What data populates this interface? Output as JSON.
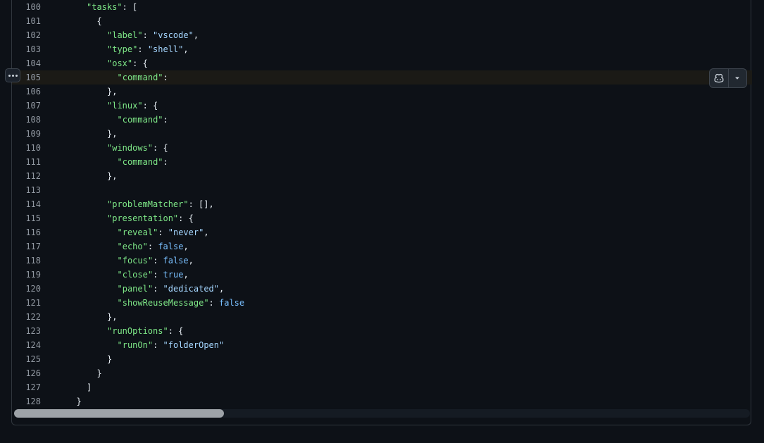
{
  "editor": {
    "lines": [
      {
        "n": "100",
        "indent": 4,
        "tokens": [
          {
            "t": "k",
            "v": "\"tasks\""
          },
          {
            "t": "p",
            "v": ": ["
          }
        ]
      },
      {
        "n": "101",
        "indent": 6,
        "tokens": [
          {
            "t": "p",
            "v": "{"
          }
        ]
      },
      {
        "n": "102",
        "indent": 8,
        "tokens": [
          {
            "t": "k",
            "v": "\"label\""
          },
          {
            "t": "p",
            "v": ": "
          },
          {
            "t": "s",
            "v": "\"vscode\""
          },
          {
            "t": "p",
            "v": ","
          }
        ]
      },
      {
        "n": "103",
        "indent": 8,
        "tokens": [
          {
            "t": "k",
            "v": "\"type\""
          },
          {
            "t": "p",
            "v": ": "
          },
          {
            "t": "s",
            "v": "\"shell\""
          },
          {
            "t": "p",
            "v": ","
          }
        ]
      },
      {
        "n": "104",
        "indent": 8,
        "tokens": [
          {
            "t": "k",
            "v": "\"osx\""
          },
          {
            "t": "p",
            "v": ": {"
          }
        ]
      },
      {
        "n": "105",
        "indent": 10,
        "active": true,
        "tokens": [
          {
            "t": "k",
            "v": "\"command\""
          },
          {
            "t": "p",
            "v": ":"
          }
        ]
      },
      {
        "n": "106",
        "indent": 8,
        "tokens": [
          {
            "t": "p",
            "v": "},"
          }
        ]
      },
      {
        "n": "107",
        "indent": 8,
        "tokens": [
          {
            "t": "k",
            "v": "\"linux\""
          },
          {
            "t": "p",
            "v": ": {"
          }
        ]
      },
      {
        "n": "108",
        "indent": 10,
        "tokens": [
          {
            "t": "k",
            "v": "\"command\""
          },
          {
            "t": "p",
            "v": ":"
          }
        ]
      },
      {
        "n": "109",
        "indent": 8,
        "tokens": [
          {
            "t": "p",
            "v": "},"
          }
        ]
      },
      {
        "n": "110",
        "indent": 8,
        "tokens": [
          {
            "t": "k",
            "v": "\"windows\""
          },
          {
            "t": "p",
            "v": ": {"
          }
        ]
      },
      {
        "n": "111",
        "indent": 10,
        "tokens": [
          {
            "t": "k",
            "v": "\"command\""
          },
          {
            "t": "p",
            "v": ":"
          }
        ]
      },
      {
        "n": "112",
        "indent": 8,
        "tokens": [
          {
            "t": "p",
            "v": "},"
          }
        ]
      },
      {
        "n": "113",
        "indent": 0,
        "tokens": []
      },
      {
        "n": "114",
        "indent": 8,
        "tokens": [
          {
            "t": "k",
            "v": "\"problemMatcher\""
          },
          {
            "t": "p",
            "v": ": [],"
          }
        ]
      },
      {
        "n": "115",
        "indent": 8,
        "tokens": [
          {
            "t": "k",
            "v": "\"presentation\""
          },
          {
            "t": "p",
            "v": ": {"
          }
        ]
      },
      {
        "n": "116",
        "indent": 10,
        "tokens": [
          {
            "t": "k",
            "v": "\"reveal\""
          },
          {
            "t": "p",
            "v": ": "
          },
          {
            "t": "s",
            "v": "\"never\""
          },
          {
            "t": "p",
            "v": ","
          }
        ]
      },
      {
        "n": "117",
        "indent": 10,
        "tokens": [
          {
            "t": "k",
            "v": "\"echo\""
          },
          {
            "t": "p",
            "v": ": "
          },
          {
            "t": "b",
            "v": "false"
          },
          {
            "t": "p",
            "v": ","
          }
        ]
      },
      {
        "n": "118",
        "indent": 10,
        "tokens": [
          {
            "t": "k",
            "v": "\"focus\""
          },
          {
            "t": "p",
            "v": ": "
          },
          {
            "t": "b",
            "v": "false"
          },
          {
            "t": "p",
            "v": ","
          }
        ]
      },
      {
        "n": "119",
        "indent": 10,
        "tokens": [
          {
            "t": "k",
            "v": "\"close\""
          },
          {
            "t": "p",
            "v": ": "
          },
          {
            "t": "b",
            "v": "true"
          },
          {
            "t": "p",
            "v": ","
          }
        ]
      },
      {
        "n": "120",
        "indent": 10,
        "tokens": [
          {
            "t": "k",
            "v": "\"panel\""
          },
          {
            "t": "p",
            "v": ": "
          },
          {
            "t": "s",
            "v": "\"dedicated\""
          },
          {
            "t": "p",
            "v": ","
          }
        ]
      },
      {
        "n": "121",
        "indent": 10,
        "tokens": [
          {
            "t": "k",
            "v": "\"showReuseMessage\""
          },
          {
            "t": "p",
            "v": ": "
          },
          {
            "t": "b",
            "v": "false"
          }
        ]
      },
      {
        "n": "122",
        "indent": 8,
        "tokens": [
          {
            "t": "p",
            "v": "},"
          }
        ]
      },
      {
        "n": "123",
        "indent": 8,
        "tokens": [
          {
            "t": "k",
            "v": "\"runOptions\""
          },
          {
            "t": "p",
            "v": ": {"
          }
        ]
      },
      {
        "n": "124",
        "indent": 10,
        "tokens": [
          {
            "t": "k",
            "v": "\"runOn\""
          },
          {
            "t": "p",
            "v": ": "
          },
          {
            "t": "s",
            "v": "\"folderOpen\""
          }
        ]
      },
      {
        "n": "125",
        "indent": 8,
        "tokens": [
          {
            "t": "p",
            "v": "}"
          }
        ]
      },
      {
        "n": "126",
        "indent": 6,
        "tokens": [
          {
            "t": "p",
            "v": "}"
          }
        ]
      },
      {
        "n": "127",
        "indent": 4,
        "tokens": [
          {
            "t": "p",
            "v": "]"
          }
        ]
      },
      {
        "n": "128",
        "indent": 2,
        "tokens": [
          {
            "t": "p",
            "v": "}"
          }
        ]
      }
    ]
  },
  "toolbar": {
    "expand_icon": "kebab-horizontal-icon",
    "copilot_icon": "copilot-icon",
    "dropdown_icon": "triangle-down-icon"
  },
  "scrollbar": {
    "horizontal_scroll_position": 0.0
  },
  "colors": {
    "key": "#7ee787",
    "string": "#a5d6ff",
    "boolean": "#79c0ff",
    "punctuation": "#e6edf3",
    "line_number": "#9198a1",
    "background": "#0d1117"
  }
}
